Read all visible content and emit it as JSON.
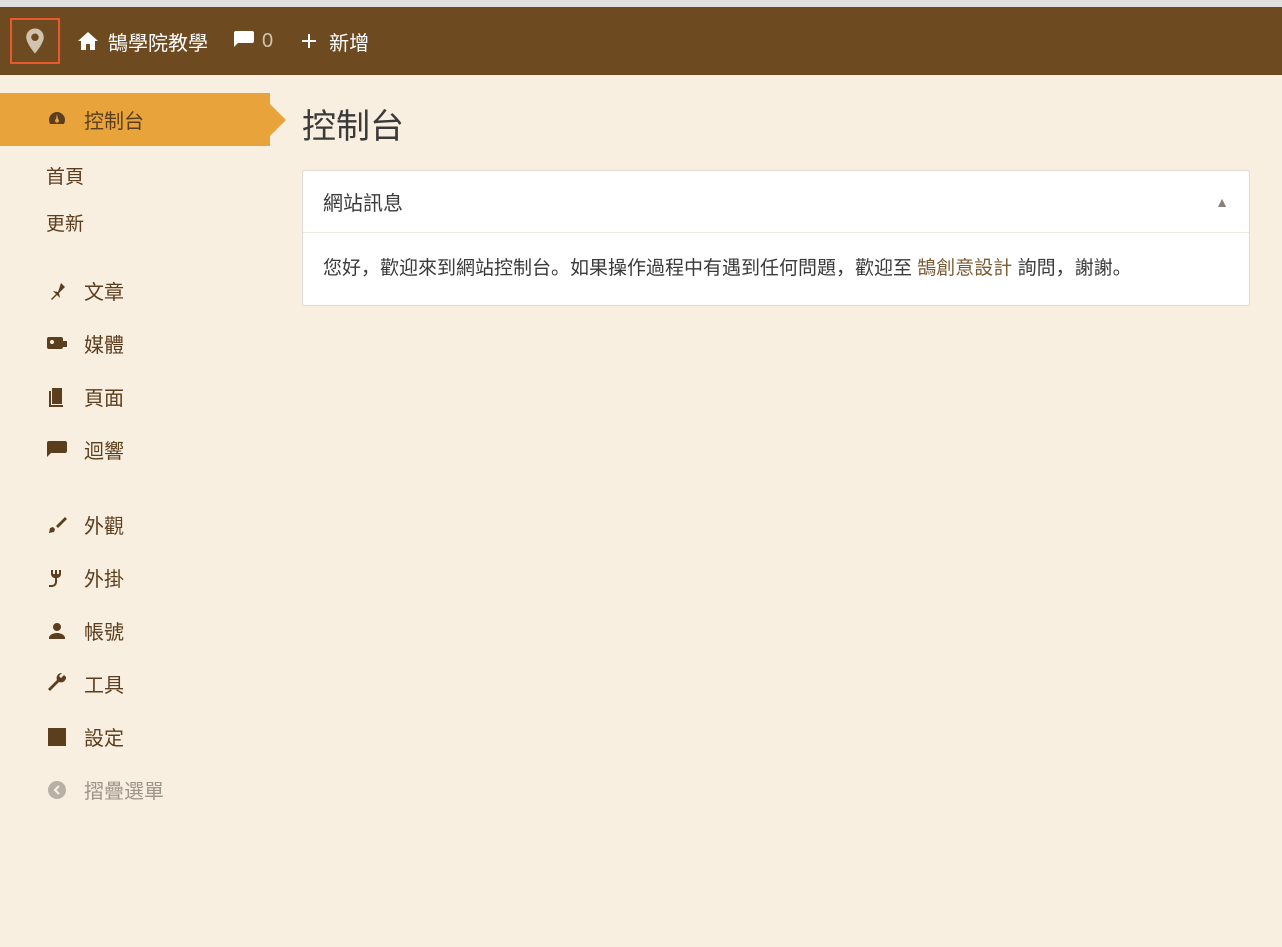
{
  "topbar": {
    "site_name": "鵠學院教學",
    "comment_count": "0",
    "new_label": "新增"
  },
  "sidebar": {
    "dashboard": "控制台",
    "submenu": {
      "home": "首頁",
      "updates": "更新"
    },
    "posts": "文章",
    "media": "媒體",
    "pages": "頁面",
    "comments": "迴響",
    "appearance": "外觀",
    "plugins": "外掛",
    "users": "帳號",
    "tools": "工具",
    "settings": "設定",
    "collapse": "摺疊選單"
  },
  "page": {
    "title": "控制台",
    "panel_title": "網站訊息",
    "panel_body_pre": "您好，歡迎來到網站控制台。如果操作過程中有遇到任何問題，歡迎至 ",
    "panel_link": "鵠創意設計",
    "panel_body_post": " 詢問，謝謝。"
  }
}
